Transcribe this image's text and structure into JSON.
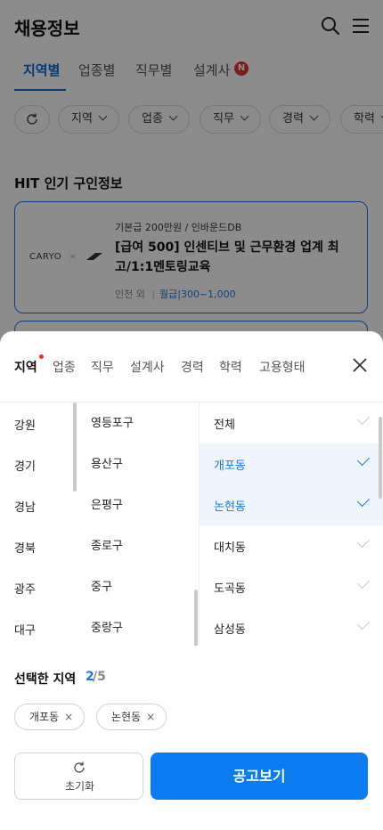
{
  "header": {
    "title": "채용정보",
    "search_icon": "search-icon",
    "menu_icon": "hamburger-menu-icon"
  },
  "tabs": [
    {
      "label": "지역별",
      "active": true
    },
    {
      "label": "업종별"
    },
    {
      "label": "직무별"
    },
    {
      "label": "설계사",
      "badge": "N"
    }
  ],
  "filters": {
    "reset_icon": "refresh-icon",
    "chips": [
      "지역",
      "업종",
      "직무",
      "경력",
      "학력"
    ]
  },
  "hit": {
    "title": "HIT 인기 구인정보",
    "card": {
      "logo_text": "CARYO",
      "logo_sep": "×",
      "subtitle": "기본급 200만원 / 인바운드DB",
      "title": "[급여 500] 인센티브 및 근무환경 업계 최고/1:1멘토링교육",
      "location": "인천 외",
      "separator": "|",
      "pay": "월급|300~1,000"
    }
  },
  "sheet": {
    "tabs": [
      {
        "label": "지역",
        "active": true,
        "dot": true
      },
      {
        "label": "업종"
      },
      {
        "label": "직무"
      },
      {
        "label": "설계사"
      },
      {
        "label": "경력"
      },
      {
        "label": "학력"
      },
      {
        "label": "고용형태"
      }
    ],
    "close_icon": "close-icon",
    "provinces": [
      "강원",
      "경기",
      "경남",
      "경북",
      "광주",
      "대구"
    ],
    "districts": [
      "영등포구",
      "용산구",
      "은평구",
      "종로구",
      "중구",
      "중랑구"
    ],
    "neighborhoods": [
      {
        "label": "전체",
        "selected": false
      },
      {
        "label": "개포동",
        "selected": true
      },
      {
        "label": "논현동",
        "selected": true
      },
      {
        "label": "대치동",
        "selected": false
      },
      {
        "label": "도곡동",
        "selected": false
      },
      {
        "label": "삼성동",
        "selected": false
      }
    ],
    "selected": {
      "title": "선택한 지역",
      "count": "2",
      "total": "/5",
      "tags": [
        "개포동",
        "논현동"
      ],
      "remove_glyph": "×"
    },
    "reset_label": "초기화",
    "view_label": "공고보기"
  },
  "colors": {
    "accent": "#0a7cf2",
    "badge": "#e8322d",
    "selected_bg": "#eef5fd"
  }
}
